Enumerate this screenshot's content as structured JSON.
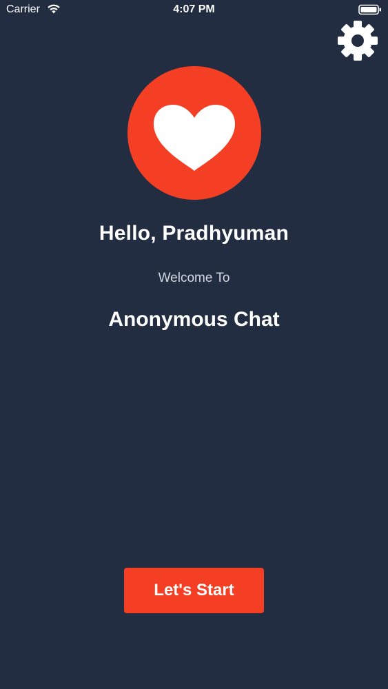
{
  "status_bar": {
    "carrier": "Carrier",
    "time": "4:07 PM",
    "wifi_icon": "wifi-icon",
    "battery_icon": "battery-icon"
  },
  "header": {
    "settings_icon": "gear-icon"
  },
  "logo": {
    "icon": "heart-icon"
  },
  "main": {
    "greeting": "Hello, Pradhyuman",
    "welcome": "Welcome To",
    "app_name": "Anonymous Chat"
  },
  "actions": {
    "start_label": "Let's Start"
  },
  "colors": {
    "background": "#222d41",
    "accent": "#f53f25",
    "text": "#ffffff",
    "muted_text": "#d3d8e0"
  }
}
